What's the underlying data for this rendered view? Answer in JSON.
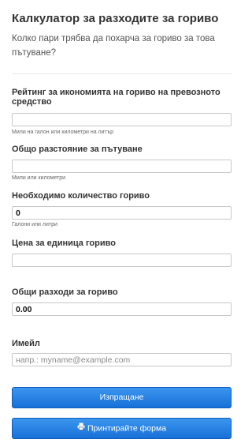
{
  "header": {
    "title": "Калкулатор за разходите за гориво",
    "subtitle": "Колко пари трябва да похарча за гориво за това пътуване?"
  },
  "form": {
    "fuel_economy": {
      "label": "Рейтинг за икономията на гориво на превозното средство",
      "value": "",
      "hint": "Мили на галон или километри на литър"
    },
    "distance": {
      "label": "Общо разстояние за пътуване",
      "value": "",
      "hint": "Мили или километри"
    },
    "fuel_needed": {
      "label": "Необходимо количество гориво",
      "value": "0",
      "hint": "Галони или литри"
    },
    "price_per_unit": {
      "label": "Цена за единица гориво",
      "value": ""
    },
    "total_cost": {
      "label": "Общи разходи за гориво",
      "value": "0.00"
    },
    "email": {
      "label": "Имейл",
      "value": "",
      "placeholder": "напр.: myname@example.com"
    }
  },
  "buttons": {
    "submit_label": "Изпращане",
    "print_label": "Принтирайте форма",
    "print_icon": "printer-icon"
  }
}
